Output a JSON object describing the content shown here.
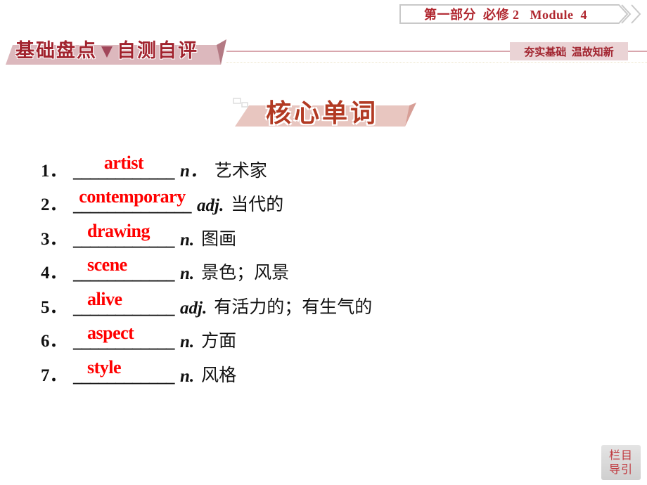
{
  "header": {
    "breadcrumb": "第一部分  必修 2   Module  4",
    "section_title_left": "基础盘点",
    "section_title_right": "自测自评",
    "tagline": "夯实基础  温故知新"
  },
  "heading": "核心单词",
  "vocab": [
    {
      "num": "1．",
      "blank": "____________",
      "answer": "artist",
      "pos": "n．",
      "meaning": "艺术家"
    },
    {
      "num": "2．",
      "blank": "______________",
      "answer": "contemporary",
      "pos": "adj.",
      "meaning": "当代的"
    },
    {
      "num": "3．",
      "blank": "____________",
      "answer": "drawing",
      "pos": "n.",
      "meaning": "图画"
    },
    {
      "num": "4．",
      "blank": "____________",
      "answer": "scene",
      "pos": "n.",
      "meaning": "景色；风景"
    },
    {
      "num": "5．",
      "blank": "____________",
      "answer": "alive",
      "pos": "adj.",
      "meaning": "有活力的；有生气的"
    },
    {
      "num": "6．",
      "blank": "____________",
      "answer": "aspect",
      "pos": "n.",
      "meaning": "方面"
    },
    {
      "num": "7．",
      "blank": "____________",
      "answer": "style",
      "pos": "n.",
      "meaning": "风格"
    }
  ],
  "nav_button": {
    "line1": "栏目",
    "line2": "导引"
  },
  "colors": {
    "accent_red": "#a1232e",
    "answer_red": "#ff0000",
    "heading_orange": "#b23a23"
  }
}
